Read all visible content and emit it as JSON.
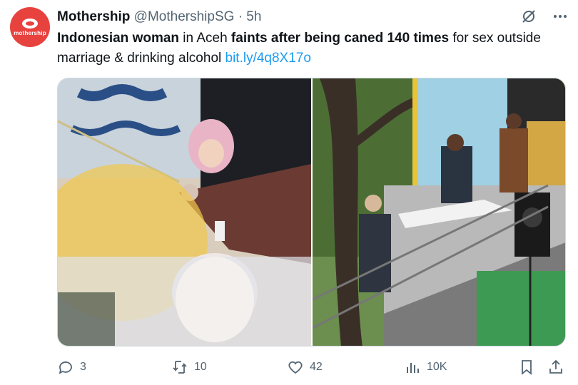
{
  "tweet": {
    "avatar_text": "mothership",
    "author_name": "Mothership",
    "handle": "@MothershipSG",
    "separator": "·",
    "time": "5h",
    "text": {
      "part1": "Indonesian woman",
      "part2": " in Aceh ",
      "part3": "faints after being caned 140 times",
      "part4": " for sex outside marriage & drinking alcohol ",
      "link": "bit.ly/4q8X17o"
    },
    "icons": [
      "no-grok-icon",
      "more-icon"
    ],
    "media": [
      {
        "name": "caning-officer-photo"
      },
      {
        "name": "woman-carried-down-stairs-photo"
      }
    ],
    "actions": {
      "replies": "3",
      "reposts": "10",
      "likes": "42",
      "views": "10K"
    },
    "colors": {
      "brand": "#e8423f",
      "link": "#1d9bf0",
      "muted": "#536471"
    }
  }
}
